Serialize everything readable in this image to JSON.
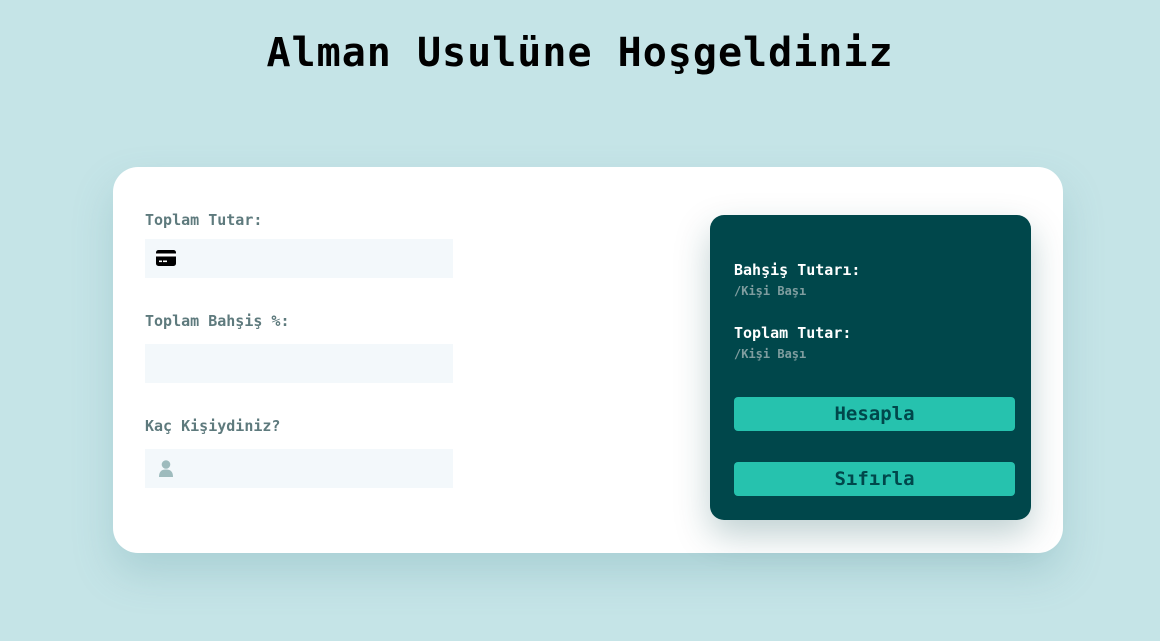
{
  "page": {
    "title": "Alman Usulüne Hoşgeldiniz"
  },
  "form": {
    "total_label": "Toplam Tutar:",
    "total_value": "",
    "total_icon": "credit-card-icon",
    "tip_label": "Toplam Bahşiş %:",
    "tip_value": "",
    "people_label": "Kaç Kişiydiniz?",
    "people_value": "",
    "people_icon": "person-icon"
  },
  "results": {
    "tip_amount_label": "Bahşiş Tutarı:",
    "tip_amount_sub": "/Kişi Başı",
    "total_amount_label": "Toplam Tutar:",
    "total_amount_sub": "/Kişi Başı",
    "calculate_button": "Hesapla",
    "reset_button": "Sıfırla"
  },
  "colors": {
    "background": "#c5e4e7",
    "card": "#ffffff",
    "panel": "#00474b",
    "accent": "#26c2ae",
    "input_bg": "#f3f8fb",
    "label": "#5e7a7d"
  }
}
